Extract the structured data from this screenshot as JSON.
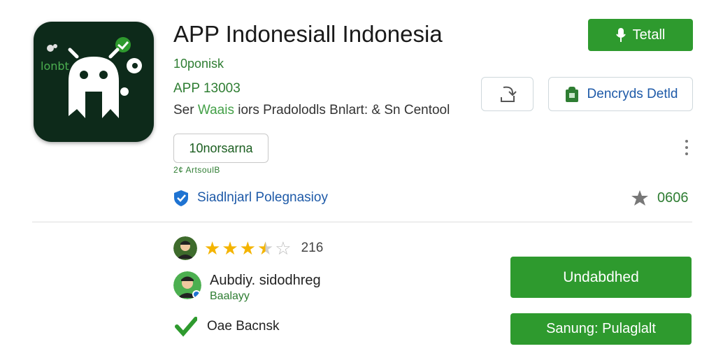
{
  "app": {
    "icon_label": "lonbt",
    "title": "APP Indonesiall Indonesia",
    "developer": "10ponisk",
    "package_line": "APP 13003",
    "description_prefix": "Ser ",
    "description_highlight": "Waais",
    "description_suffix": " iors Pradolodls Bnlart: & Sn Centool",
    "category_chip": "10norsarna",
    "chip_note": "2¢ ArtsoulB",
    "verified_text": "Siadlnjarl Polegnasioy",
    "rating_count": "0606"
  },
  "actions": {
    "primary_label": "Tetall",
    "secondary_label": "Dencryds Detld"
  },
  "reviews": {
    "stars": 3.5,
    "count": "216",
    "author_name": "Aubdiy. sidodhreg",
    "author_sub": "Baalayy",
    "check_text": "Oae Bacnsk"
  },
  "buttons": {
    "big_label": "Undabdhed",
    "second_label": "Sanung: Pulaglalt"
  },
  "colors": {
    "accent_green": "#2e9a2e",
    "icon_bg": "#0d2a1a",
    "link_blue": "#1e5aa8",
    "star_gold": "#f4b400"
  }
}
